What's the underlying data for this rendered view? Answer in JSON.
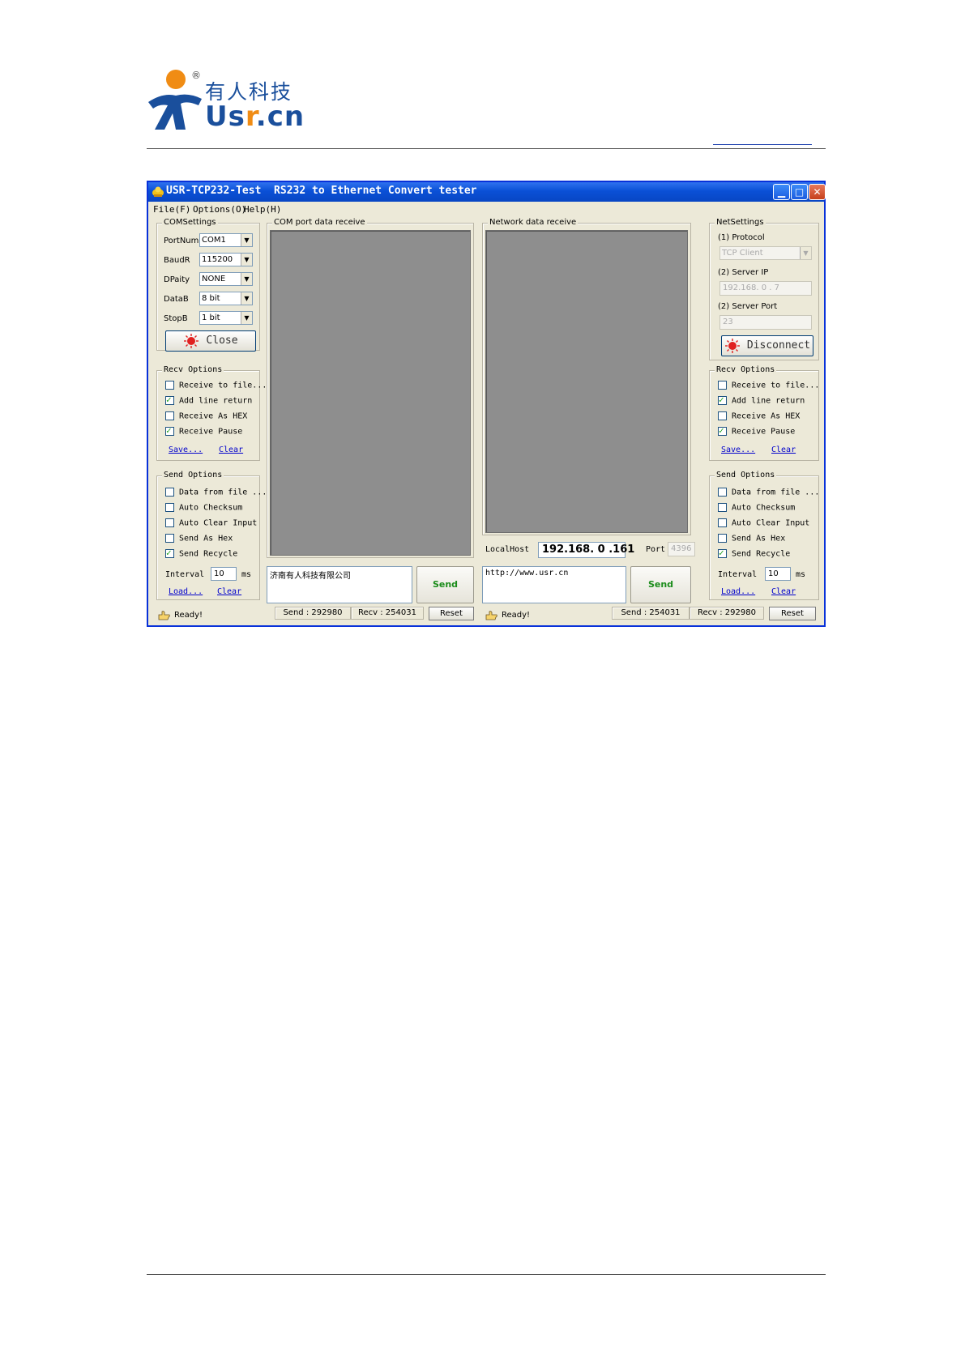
{
  "logo": {
    "reg": "®",
    "cn": "有人科技",
    "en_a": "Us",
    "en_b": "r",
    "en_c": ".cn"
  },
  "window": {
    "title": "USR-TCP232-Test  RS232 to Ethernet Convert tester",
    "menu": [
      "File(F)",
      "Options(O)",
      "Help(H)"
    ]
  },
  "com_settings": {
    "title": "COMSettings",
    "fields": [
      {
        "label": "PortNum",
        "value": "COM1"
      },
      {
        "label": "BaudR",
        "value": "115200"
      },
      {
        "label": "DPaity",
        "value": "NONE"
      },
      {
        "label": "DataB",
        "value": "8 bit"
      },
      {
        "label": "StopB",
        "value": "1 bit"
      }
    ],
    "button": "Close"
  },
  "left_recv_options": {
    "title": "Recv Options",
    "items": [
      {
        "label": "Receive to file...",
        "checked": false
      },
      {
        "label": "Add line return",
        "checked": true
      },
      {
        "label": "Receive As HEX",
        "checked": false
      },
      {
        "label": "Receive Pause",
        "checked": true
      }
    ],
    "save": "Save...",
    "clear": "Clear"
  },
  "left_send_options": {
    "title": "Send Options",
    "items": [
      {
        "label": "Data from file ...",
        "checked": false
      },
      {
        "label": "Auto Checksum",
        "checked": false
      },
      {
        "label": "Auto Clear Input",
        "checked": false
      },
      {
        "label": "Send As Hex",
        "checked": false
      },
      {
        "label": "Send Recycle",
        "checked": true
      }
    ],
    "interval_label": "Interval",
    "interval_value": "10",
    "interval_unit": "ms",
    "load": "Load...",
    "clear": "Clear"
  },
  "com_receive": {
    "title": "COM port data receive",
    "send_text": "济南有人科技有限公司",
    "send_button": "Send"
  },
  "net_receive": {
    "title": "Network data receive",
    "localhost_label": "LocalHost",
    "localhost_ip": "192.168. 0 .161",
    "port_label": "Port",
    "port_value": "4396",
    "send_text": "http://www.usr.cn",
    "send_button": "Send"
  },
  "net_settings": {
    "title": "NetSettings",
    "protocol_label": "(1) Protocol",
    "protocol_value": "TCP Client",
    "server_ip_label": "(2) Server IP",
    "server_ip_value": "192.168. 0 . 7",
    "server_port_label": "(2) Server Port",
    "server_port_value": "23",
    "button": "Disconnect"
  },
  "right_recv_options": {
    "title": "Recv Options",
    "items": [
      {
        "label": "Receive to file...",
        "checked": false
      },
      {
        "label": "Add line return",
        "checked": true
      },
      {
        "label": "Receive As HEX",
        "checked": false
      },
      {
        "label": "Receive Pause",
        "checked": true
      }
    ],
    "save": "Save...",
    "clear": "Clear"
  },
  "right_send_options": {
    "title": "Send Options",
    "items": [
      {
        "label": "Data from file ...",
        "checked": false
      },
      {
        "label": "Auto Checksum",
        "checked": false
      },
      {
        "label": "Auto Clear Input",
        "checked": false
      },
      {
        "label": "Send As Hex",
        "checked": false
      },
      {
        "label": "Send Recycle",
        "checked": true
      }
    ],
    "interval_label": "Interval",
    "interval_value": "10",
    "interval_unit": "ms",
    "load": "Load...",
    "clear": "Clear"
  },
  "status_left": {
    "text": "Ready!",
    "send": "Send : 292980",
    "recv": "Recv : 254031",
    "reset": "Reset"
  },
  "status_right": {
    "text": "Ready!",
    "send": "Send : 254031",
    "recv": "Recv : 292980",
    "reset": "Reset"
  }
}
